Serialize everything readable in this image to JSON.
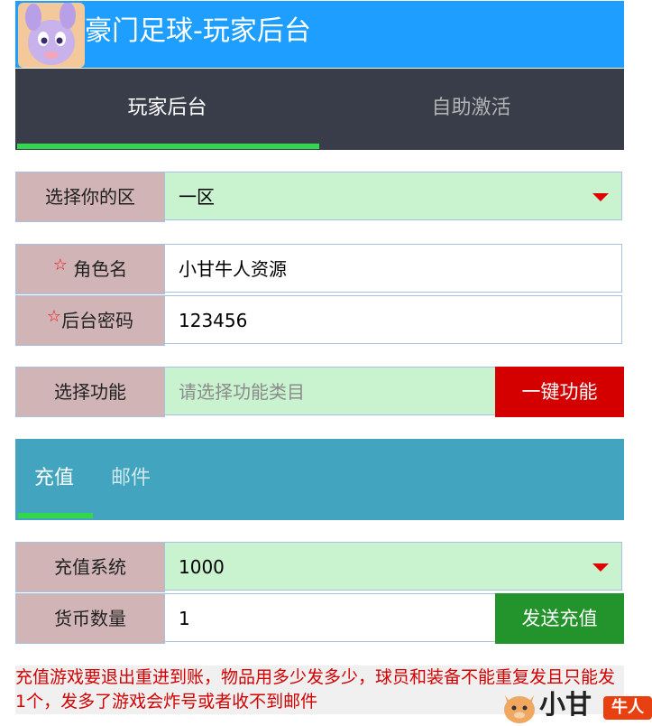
{
  "header": {
    "title": "豪门足球-玩家后台",
    "logo_icon": "cartoon-creature-avatar"
  },
  "top_tabs": [
    {
      "label": "玩家后台",
      "active": true
    },
    {
      "label": "自助激活",
      "active": false
    }
  ],
  "form": {
    "server": {
      "label": "选择你的区",
      "value": "一区"
    },
    "role_name": {
      "label": "角色名",
      "value": "小甘牛人资源",
      "required_mark": "☆"
    },
    "password": {
      "label": "后台密码",
      "value": "123456",
      "required_mark": "☆"
    },
    "function": {
      "label": "选择功能",
      "placeholder": "请选择功能类目",
      "button": "一键功能"
    }
  },
  "sub_tabs": [
    {
      "label": "充值",
      "active": true
    },
    {
      "label": "邮件",
      "active": false
    }
  ],
  "recharge": {
    "system": {
      "label": "充值系统",
      "value": "1000"
    },
    "amount": {
      "label": "货币数量",
      "value": "1",
      "button": "发送充值"
    }
  },
  "notice": "充值游戏要退出重进到账，物品用多少发多少，球员和装备不能重复发且只能发1个，发多了游戏会炸号或者收不到邮件",
  "watermark": {
    "text": "小甘",
    "badge": "牛人"
  },
  "colors": {
    "header_bg": "#1e9fff",
    "tabs_bg": "#393d49",
    "indicator": "#32d74b",
    "label_bg": "#d1b4b6",
    "select_bg": "#c9f2cf",
    "btn_red": "#d40000",
    "btn_green": "#23932c",
    "subtabs_bg": "#42a4bf",
    "notice_text": "#d40000"
  }
}
